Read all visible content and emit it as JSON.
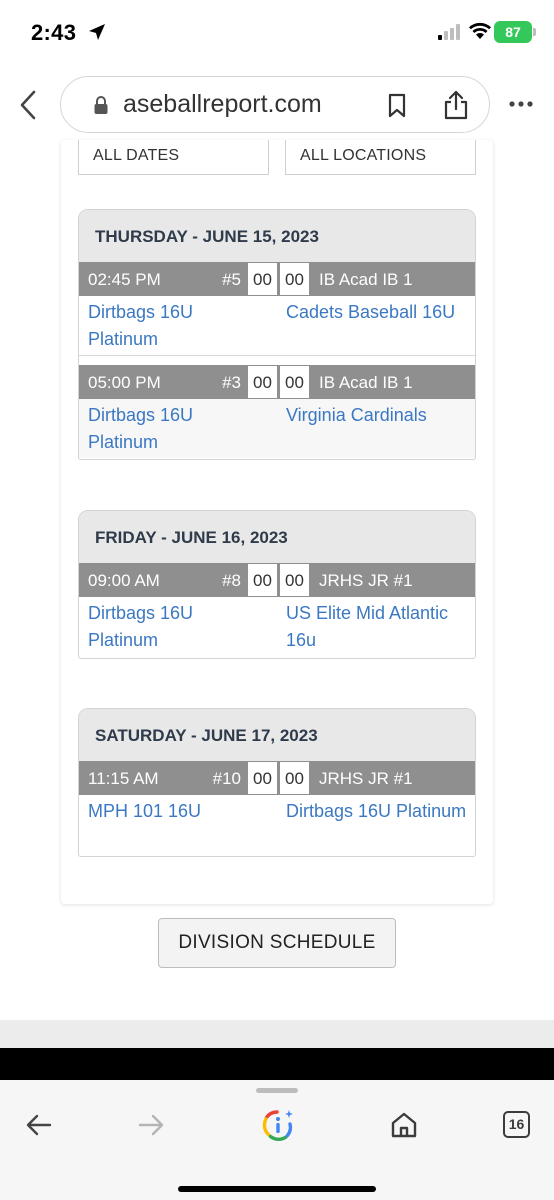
{
  "status_bar": {
    "time": "2:43",
    "battery": "87",
    "battery_color": "#34c759"
  },
  "browser": {
    "url": "aseballreport.com",
    "icons": [
      "back-icon",
      "lock-icon",
      "bookmark-icon",
      "share-icon",
      "more-icon"
    ]
  },
  "filters": {
    "dates": "ALL DATES",
    "locations": "ALL LOCATIONS"
  },
  "days": [
    {
      "label": "THURSDAY - JUNE 15, 2023",
      "games": [
        {
          "time": "02:45 PM",
          "number": "#5",
          "score_a": "00",
          "score_b": "00",
          "field": "IB Acad IB 1",
          "team_a": "Dirtbags 16U Platinum",
          "team_b": "Cadets Baseball 16U"
        },
        {
          "time": "05:00 PM",
          "number": "#3",
          "score_a": "00",
          "score_b": "00",
          "field": "IB Acad IB 1",
          "team_a": "Dirtbags 16U Platinum",
          "team_b": "Virginia Cardinals"
        }
      ]
    },
    {
      "label": "FRIDAY - JUNE 16, 2023",
      "games": [
        {
          "time": "09:00 AM",
          "number": "#8",
          "score_a": "00",
          "score_b": "00",
          "field": "JRHS JR #1",
          "team_a": "Dirtbags 16U Platinum",
          "team_b": "US Elite Mid Atlantic 16u"
        }
      ]
    },
    {
      "label": "SATURDAY - JUNE 17, 2023",
      "games": [
        {
          "time": "11:15 AM",
          "number": "#10",
          "score_a": "00",
          "score_b": "00",
          "field": "JRHS JR #1",
          "team_a": "MPH 101 16U",
          "team_b": "Dirtbags 16U Platinum"
        }
      ]
    }
  ],
  "division_button": "DIVISION SCHEDULE",
  "toolbar": {
    "tab_count": "16"
  },
  "colors": {
    "link": "#3b78c3",
    "game_bar": "#8f8f8f",
    "day_header": "#e8e8e8"
  }
}
